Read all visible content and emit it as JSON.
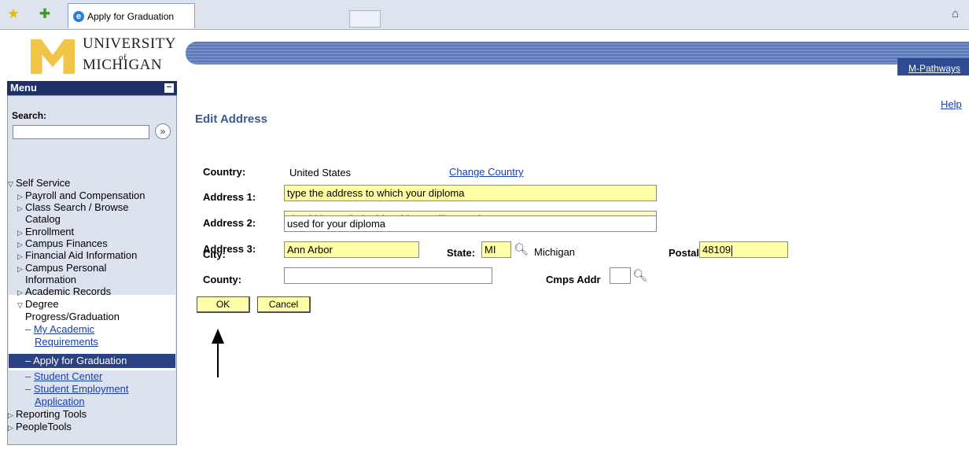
{
  "browser": {
    "tab_title": "Apply for Graduation",
    "icons": [
      "star-favorites-icon",
      "add-favorites-icon",
      "ie-page-icon",
      "home-icon"
    ]
  },
  "header": {
    "logo_line1": "UNIVERSITY",
    "logo_line2": "of",
    "logo_line3": "MICHIGAN",
    "mpathways_link": "M-Pathways"
  },
  "menu": {
    "title": "Menu",
    "search_label": "Search:",
    "search_value": "",
    "search_go_glyph": "»",
    "items": [
      {
        "label": "Self Service",
        "state": "expanded"
      },
      {
        "label": "Payroll and Compensation",
        "state": "collapsed"
      },
      {
        "label": "Class Search / Browse",
        "state": "collapsed"
      },
      {
        "label": "Catalog",
        "state": "wrap"
      },
      {
        "label": "Enrollment",
        "state": "collapsed"
      },
      {
        "label": "Campus Finances",
        "state": "collapsed"
      },
      {
        "label": "Financial Aid Information",
        "state": "collapsed"
      },
      {
        "label": "Campus Personal",
        "state": "collapsed"
      },
      {
        "label": "Information",
        "state": "wrap"
      },
      {
        "label": "Academic Records",
        "state": "collapsed"
      },
      {
        "label": "Degree",
        "state": "expanded"
      },
      {
        "label": "Progress/Graduation",
        "state": "wrap"
      },
      {
        "label": "My Academic",
        "state": "link"
      },
      {
        "label": "Requirements",
        "state": "link-wrap"
      },
      {
        "label": "Apply for Graduation",
        "state": "selected"
      },
      {
        "label": "Student Center",
        "state": "link"
      },
      {
        "label": "Student Employment",
        "state": "link"
      },
      {
        "label": "Application",
        "state": "link-wrap"
      },
      {
        "label": "Reporting Tools",
        "state": "collapsed"
      },
      {
        "label": "PeopleTools",
        "state": "collapsed"
      }
    ]
  },
  "content": {
    "help": "Help",
    "title": "Edit Address",
    "country_label": "Country:",
    "country_value": "United States",
    "change_country": "Change Country",
    "address1_label": "Address 1:",
    "address1_value": "type the address to which your diploma",
    "address2_label": "Address 2:",
    "address2_value": "should be mailed.  This address will ONLY be",
    "address3_label": "Address 3:",
    "address3_value": "used for your diploma",
    "city_label": "City:",
    "city_value": "Ann Arbor",
    "state_label": "State:",
    "state_value": "MI",
    "state_name": "Michigan",
    "postal_label": "Postal:",
    "postal_value": "48109",
    "county_label": "County:",
    "county_value": "",
    "cmps_label": "Cmps Addr",
    "cmps_value": "",
    "ok": "OK",
    "cancel": "Cancel"
  },
  "colors": {
    "highlight_field": "#ffffa8",
    "menu_header": "#1e3066",
    "link": "#1a3fa6",
    "title": "#3a5a8f"
  }
}
